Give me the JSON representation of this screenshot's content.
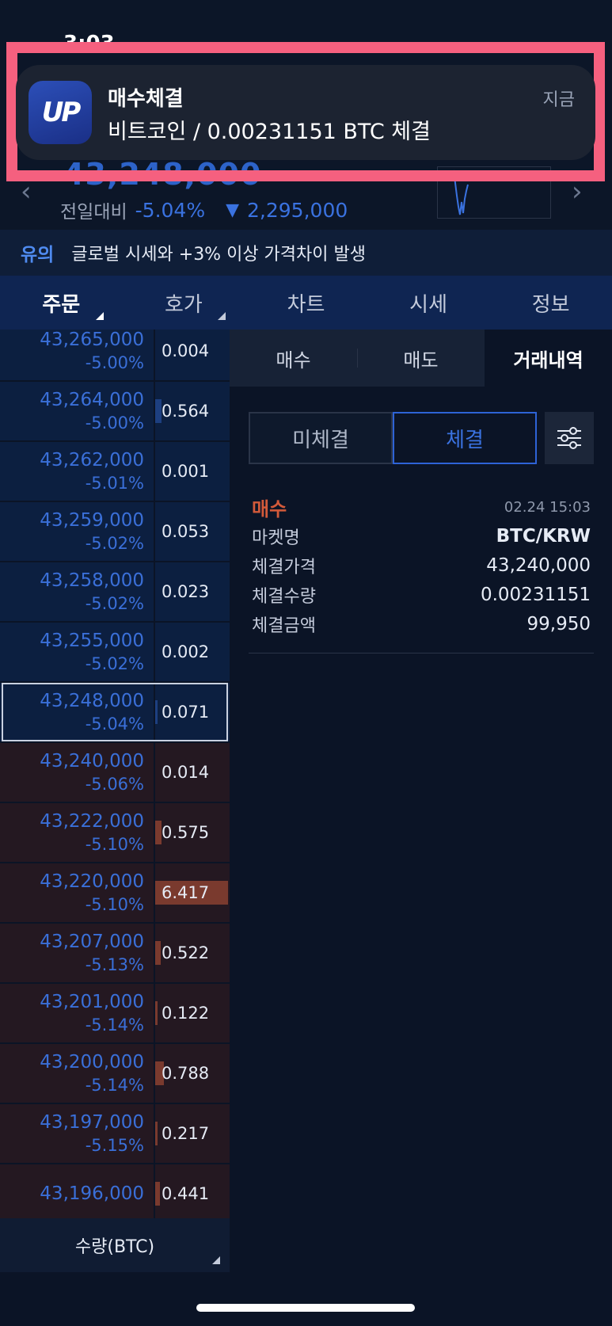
{
  "status": {
    "time": "3:03"
  },
  "header": {
    "price": "43,248,000",
    "change_label": "전일대비",
    "change_pct": "-5.04%",
    "change_amount": "2,295,000",
    "down_symbol": "▼",
    "prev_icon": "chevron-left-icon",
    "next_icon": "chevron-right-icon"
  },
  "notification": {
    "app_icon_text": "UP",
    "title": "매수체결",
    "body": "비트코인 / 0.00231151 BTC 체결",
    "time": "지금",
    "highlight_color": "#f5607f"
  },
  "notice": {
    "tag": "유의",
    "message": "글로벌 시세와 +3% 이상 가격차이 발생"
  },
  "tabs": [
    {
      "label": "주문",
      "active": true
    },
    {
      "label": "호가"
    },
    {
      "label": "차트"
    },
    {
      "label": "시세"
    },
    {
      "label": "정보"
    }
  ],
  "orderbook": {
    "asks": [
      {
        "price": "43,265,000",
        "rate": "-5.00%",
        "qty": "0.004",
        "depth": 0.0
      },
      {
        "price": "43,264,000",
        "rate": "-5.00%",
        "qty": "0.564",
        "depth": 0.09
      },
      {
        "price": "43,262,000",
        "rate": "-5.01%",
        "qty": "0.001",
        "depth": 0.0
      },
      {
        "price": "43,259,000",
        "rate": "-5.02%",
        "qty": "0.053",
        "depth": 0.0
      },
      {
        "price": "43,258,000",
        "rate": "-5.02%",
        "qty": "0.023",
        "depth": 0.0
      },
      {
        "price": "43,255,000",
        "rate": "-5.02%",
        "qty": "0.002",
        "depth": 0.0
      },
      {
        "price": "43,248,000",
        "rate": "-5.04%",
        "qty": "0.071",
        "depth": 0.01,
        "selected": true
      }
    ],
    "bids": [
      {
        "price": "43,240,000",
        "rate": "-5.06%",
        "qty": "0.014",
        "depth": 0.0
      },
      {
        "price": "43,222,000",
        "rate": "-5.10%",
        "qty": "0.575",
        "depth": 0.09
      },
      {
        "price": "43,220,000",
        "rate": "-5.10%",
        "qty": "6.417",
        "depth": 1.0
      },
      {
        "price": "43,207,000",
        "rate": "-5.13%",
        "qty": "0.522",
        "depth": 0.08
      },
      {
        "price": "43,201,000",
        "rate": "-5.14%",
        "qty": "0.122",
        "depth": 0.02
      },
      {
        "price": "43,200,000",
        "rate": "-5.14%",
        "qty": "0.788",
        "depth": 0.12
      },
      {
        "price": "43,197,000",
        "rate": "-5.15%",
        "qty": "0.217",
        "depth": 0.03
      },
      {
        "price": "43,196,000",
        "rate": "",
        "qty": "0.441",
        "depth": 0.07
      }
    ],
    "footer_label": "수량(BTC)"
  },
  "panel": {
    "tabs": [
      {
        "label": "매수"
      },
      {
        "label": "매도"
      },
      {
        "label": "거래내역",
        "active": true
      }
    ],
    "segments": [
      {
        "label": "미체결"
      },
      {
        "label": "체결",
        "active": true
      }
    ],
    "filter_icon": "sliders-icon",
    "trade": {
      "side": "매수",
      "timestamp": "02.24 15:03",
      "rows": [
        {
          "label": "마켓명",
          "value": "BTC/KRW",
          "bold": true
        },
        {
          "label": "체결가격",
          "value": "43,240,000"
        },
        {
          "label": "체결수량",
          "value": "0.00231151"
        },
        {
          "label": "체결금액",
          "value": "99,950"
        }
      ]
    }
  },
  "colors": {
    "ask_bg": "#0c1f40",
    "bid_bg": "#241821",
    "ask_text": "#3a6fd8",
    "buy_red": "#d35a3a",
    "accent_blue": "#2e63d6"
  }
}
